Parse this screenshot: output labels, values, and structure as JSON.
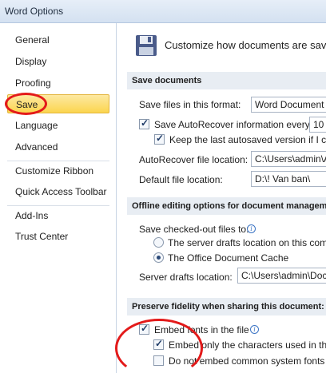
{
  "window": {
    "title": "Word Options"
  },
  "sidebar": {
    "items": [
      {
        "label": "General"
      },
      {
        "label": "Display"
      },
      {
        "label": "Proofing"
      },
      {
        "label": "Save",
        "selected": true
      },
      {
        "label": "Language"
      },
      {
        "label": "Advanced"
      },
      {
        "label": "Customize Ribbon"
      },
      {
        "label": "Quick Access Toolbar"
      },
      {
        "label": "Add-Ins"
      },
      {
        "label": "Trust Center"
      }
    ]
  },
  "main": {
    "header": "Customize how documents are sav",
    "save_documents": {
      "title": "Save documents",
      "format_label": "Save files in this format:",
      "format_value": "Word Document",
      "autorecover_label": "Save AutoRecover information every",
      "autorecover_checked": true,
      "autorecover_minutes": "10",
      "keep_last_label": "Keep the last autosaved version if I clo",
      "keep_last_checked": true,
      "ar_location_label": "AutoRecover file location:",
      "ar_location_value": "C:\\Users\\admin\\A",
      "default_location_label": "Default file location:",
      "default_location_value": "D:\\!  Van ban\\"
    },
    "offline": {
      "title": "Offline editing options for document managem",
      "checkout_label": "Save checked-out files to:",
      "server_drafts_label": "The server drafts location on this comp",
      "server_drafts_selected": false,
      "office_cache_label": "The Office Document Cache",
      "office_cache_selected": true,
      "drafts_location_label": "Server drafts location:",
      "drafts_location_value": "C:\\Users\\admin\\Docu"
    },
    "fidelity": {
      "title": "Preserve fidelity when sharing this document:",
      "embed_fonts_label": "Embed fonts in the file",
      "embed_fonts_checked": true,
      "embed_only_label": "Embed only the characters used in the",
      "embed_only_checked": true,
      "no_common_label": "Do not embed common system fonts",
      "no_common_checked": false
    }
  },
  "colors": {
    "annotation": "#e31a1a",
    "selected_bg": "#fbd54e"
  }
}
